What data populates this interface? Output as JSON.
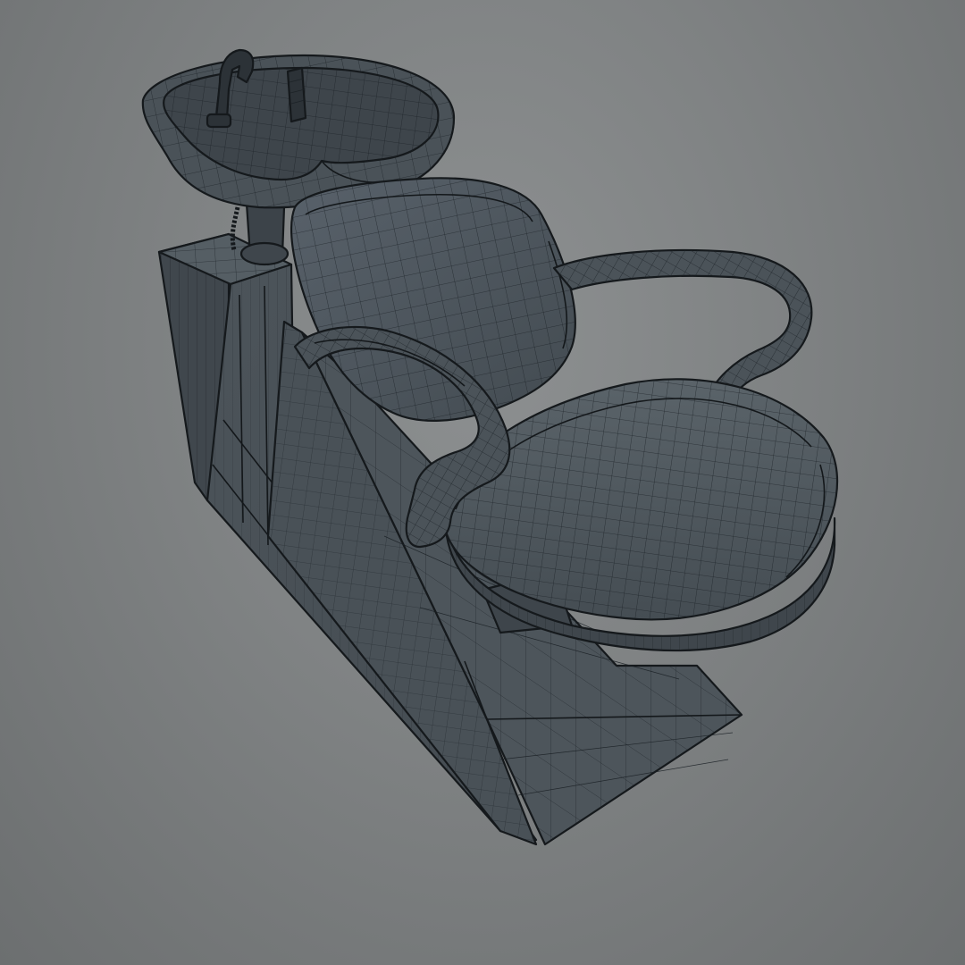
{
  "scene": {
    "subject": "",
    "render_style": "wireframe-shaded",
    "colors": {
      "background": "#7f8283",
      "mesh_fill": "#4a5258",
      "mesh_fill_dark": "#3c4349",
      "mesh_fill_light": "#5a6369",
      "wire": "#1a2025",
      "outline": "#15191c"
    }
  }
}
